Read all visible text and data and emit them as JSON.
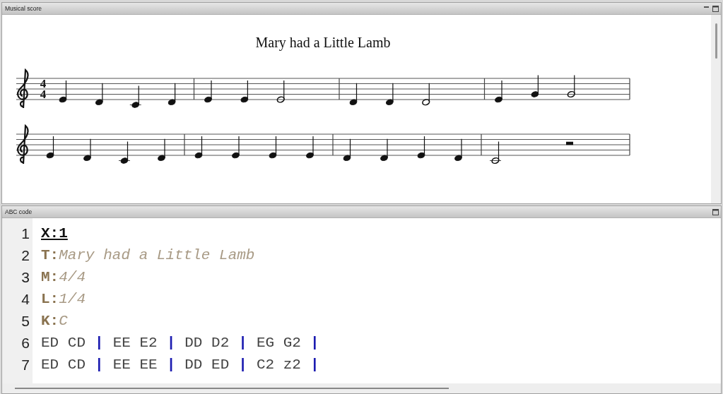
{
  "score_panel": {
    "title": "Musical score",
    "tune_title": "Mary had a Little Lamb",
    "time_signature": [
      "4",
      "4"
    ]
  },
  "code_panel": {
    "title": "ABC code",
    "lines": [
      {
        "number": "1",
        "kind": "index",
        "key": "X:",
        "value": "1"
      },
      {
        "number": "2",
        "kind": "header",
        "key": "T:",
        "value": "Mary had a Little Lamb"
      },
      {
        "number": "3",
        "kind": "header",
        "key": "M:",
        "value": "4/4"
      },
      {
        "number": "4",
        "kind": "header",
        "key": "L:",
        "value": "1/4"
      },
      {
        "number": "5",
        "kind": "header",
        "key": "K:",
        "value": "C"
      },
      {
        "number": "6",
        "kind": "music",
        "separator": "|",
        "bars": [
          "ED CD",
          "EE E2",
          "DD D2",
          "EG G2"
        ]
      },
      {
        "number": "7",
        "kind": "music",
        "separator": "|",
        "bars": [
          "ED CD",
          "EE EE",
          "DD ED",
          "C2 z2"
        ]
      }
    ]
  }
}
